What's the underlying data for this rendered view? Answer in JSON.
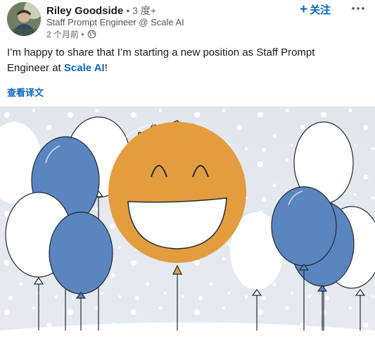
{
  "post": {
    "author": {
      "name": "Riley Goodside",
      "degree": "• 3 度+",
      "headline": "Staff Prompt Engineer @ Scale AI",
      "timestamp": "2 个月前 •",
      "visibility_icon": "globe-icon",
      "avatar_icon": "avatar-photo"
    },
    "follow_label": "关注",
    "more_icon": "more-options-icon",
    "text_before": "I’m happy to share that I’m starting a new position as Staff Prompt Engineer at ",
    "mention": "Scale AI",
    "text_after": "!",
    "translate_label": "查看译文",
    "image": {
      "description_icon": "celebration-balloons-smiley",
      "colors": {
        "background": "#e2e7ee",
        "balloon_blue": "#5b85bf",
        "balloon_white": "#ffffff",
        "smiley_orange": "#e39d3e",
        "accent_link": "#0a66c2"
      }
    }
  }
}
